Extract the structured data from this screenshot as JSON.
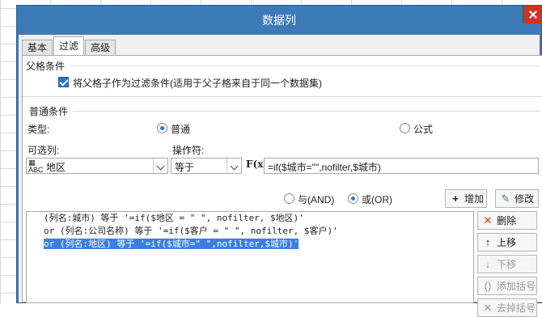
{
  "dialog": {
    "title": "数据列"
  },
  "tabs": [
    {
      "label": "基本"
    },
    {
      "label": "过滤"
    },
    {
      "label": "高级"
    }
  ],
  "parent_section": {
    "title": "父格条件",
    "checkbox_label": "将父格子作为过滤条件(适用于父子格来自于同一个数据集)",
    "checked": true
  },
  "normal_section": {
    "title": "普通条件",
    "type_label": "类型:",
    "type_options": [
      {
        "label": "普通",
        "selected": true
      },
      {
        "label": "公式",
        "selected": false
      }
    ],
    "column_label": "可选列:",
    "column_value": "地区",
    "operator_label": "操作符:",
    "operator_value": "等于",
    "formula_icon": "F(x)",
    "formula_value": "=if($城市=\"\",nofilter,$城市)"
  },
  "logic": {
    "and_label": "与(AND)",
    "or_label": "或(OR)",
    "selected": "or",
    "add_label": "增加",
    "modify_label": "修改"
  },
  "conditions": [
    {
      "text": "(列名:城市) 等于 '=if($地区 = \" \", nofilter, $地区)'",
      "selected": false
    },
    {
      "text": "or (列名:公司名称) 等于 '=if($客户 = \" \", nofilter, $客户)'",
      "selected": false
    },
    {
      "text": "or (列名:地区) 等于 '=if($城市=\" \",nofilter,$城市)'",
      "selected": true
    }
  ],
  "side_buttons": {
    "delete_label": "删除",
    "up_label": "上移",
    "down_label": "下移",
    "add_bracket_label": "添加括号",
    "remove_bracket_label": "去掉括号"
  },
  "colors": {
    "title_bar": "#3c7ab8",
    "selection": "#3a7fe0",
    "delete_icon": "#d2362b",
    "checkbox": "#2f74c8"
  }
}
